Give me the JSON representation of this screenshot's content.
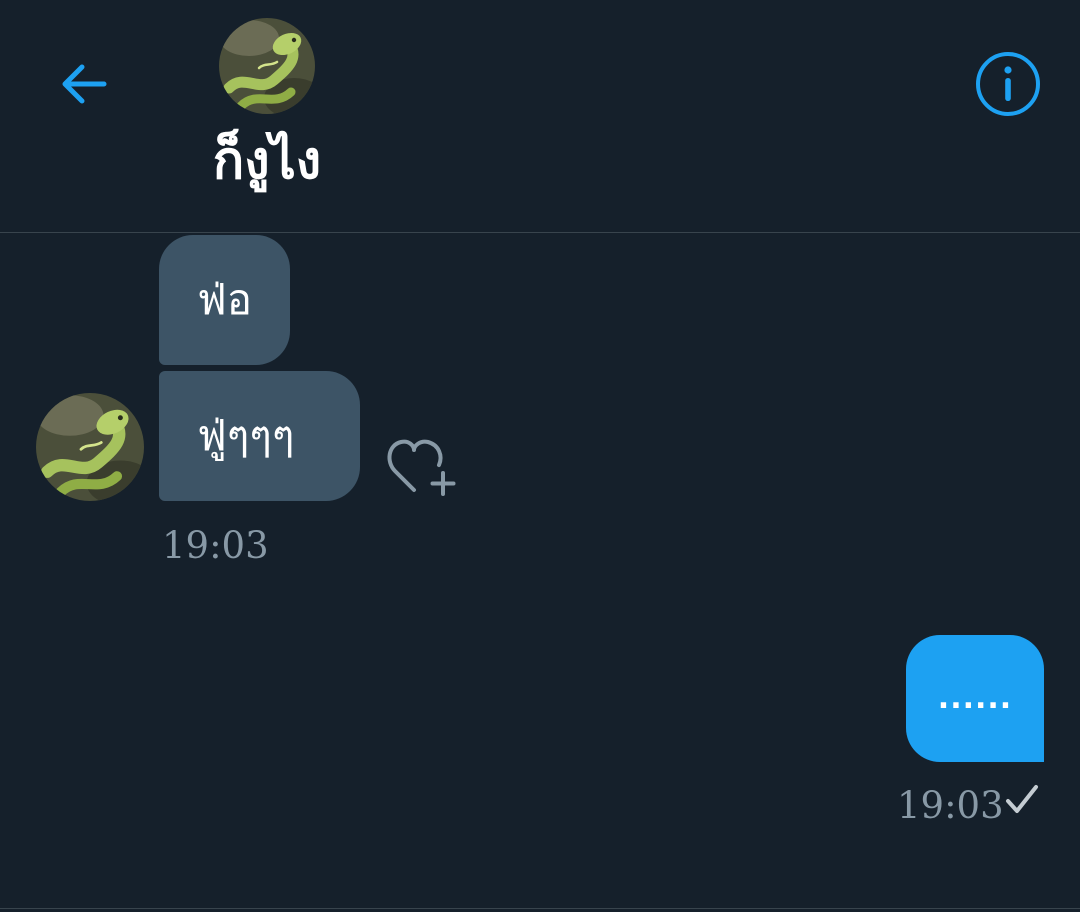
{
  "header": {
    "title": "ก็งูไง",
    "back_icon": "arrow-left-icon",
    "info_icon": "info-circle-icon",
    "accent_color": "#1da1f2"
  },
  "conversation": {
    "incoming": {
      "messages": [
        {
          "text": "ฟ่อ"
        },
        {
          "text": "ฟู่ๆๆๆ"
        }
      ],
      "timestamp": "19:03",
      "like_icon": "heart-plus-icon"
    },
    "outgoing": {
      "messages": [
        {
          "text": "......"
        }
      ],
      "timestamp": "19:03",
      "status_icon": "checkmark-icon"
    }
  },
  "colors": {
    "background": "#15202b",
    "incoming_bubble": "#3d5466",
    "outgoing_bubble": "#1da1f2",
    "muted_text": "#8899a6",
    "divider": "#38444d"
  }
}
